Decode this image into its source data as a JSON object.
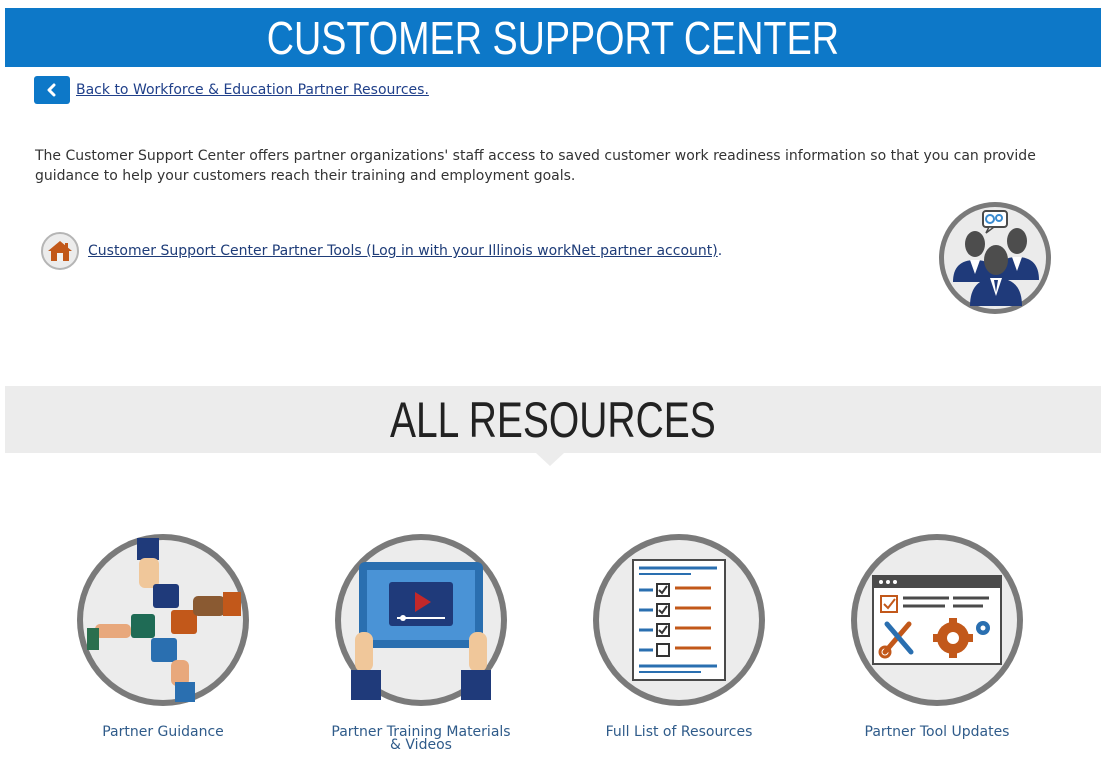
{
  "header": {
    "title": "CUSTOMER SUPPORT CENTER"
  },
  "nav": {
    "back_label": "Back to Workforce & Education Partner Resources."
  },
  "intro": {
    "text": "The Customer Support Center offers partner organizations' staff access to saved customer work readiness information so that you can provide guidance to help your customers reach their training and employment goals."
  },
  "tools": {
    "link_label": "Customer Support Center Partner Tools (Log in with your Illinois workNet partner account)",
    "suffix": "."
  },
  "resources": {
    "title": "ALL RESOURCES",
    "items": [
      {
        "label": "Partner Guidance",
        "icon": "puzzle-hands-icon"
      },
      {
        "label": "Partner Training Materials & Videos",
        "icon": "tablet-video-icon"
      },
      {
        "label": "Full List of Resources",
        "icon": "checklist-icon"
      },
      {
        "label": "Partner Tool Updates",
        "icon": "tools-gear-icon"
      }
    ]
  },
  "colors": {
    "brand_blue": "#0d78c8",
    "band_gray": "#ececec",
    "link_blue": "#1e3c78"
  }
}
